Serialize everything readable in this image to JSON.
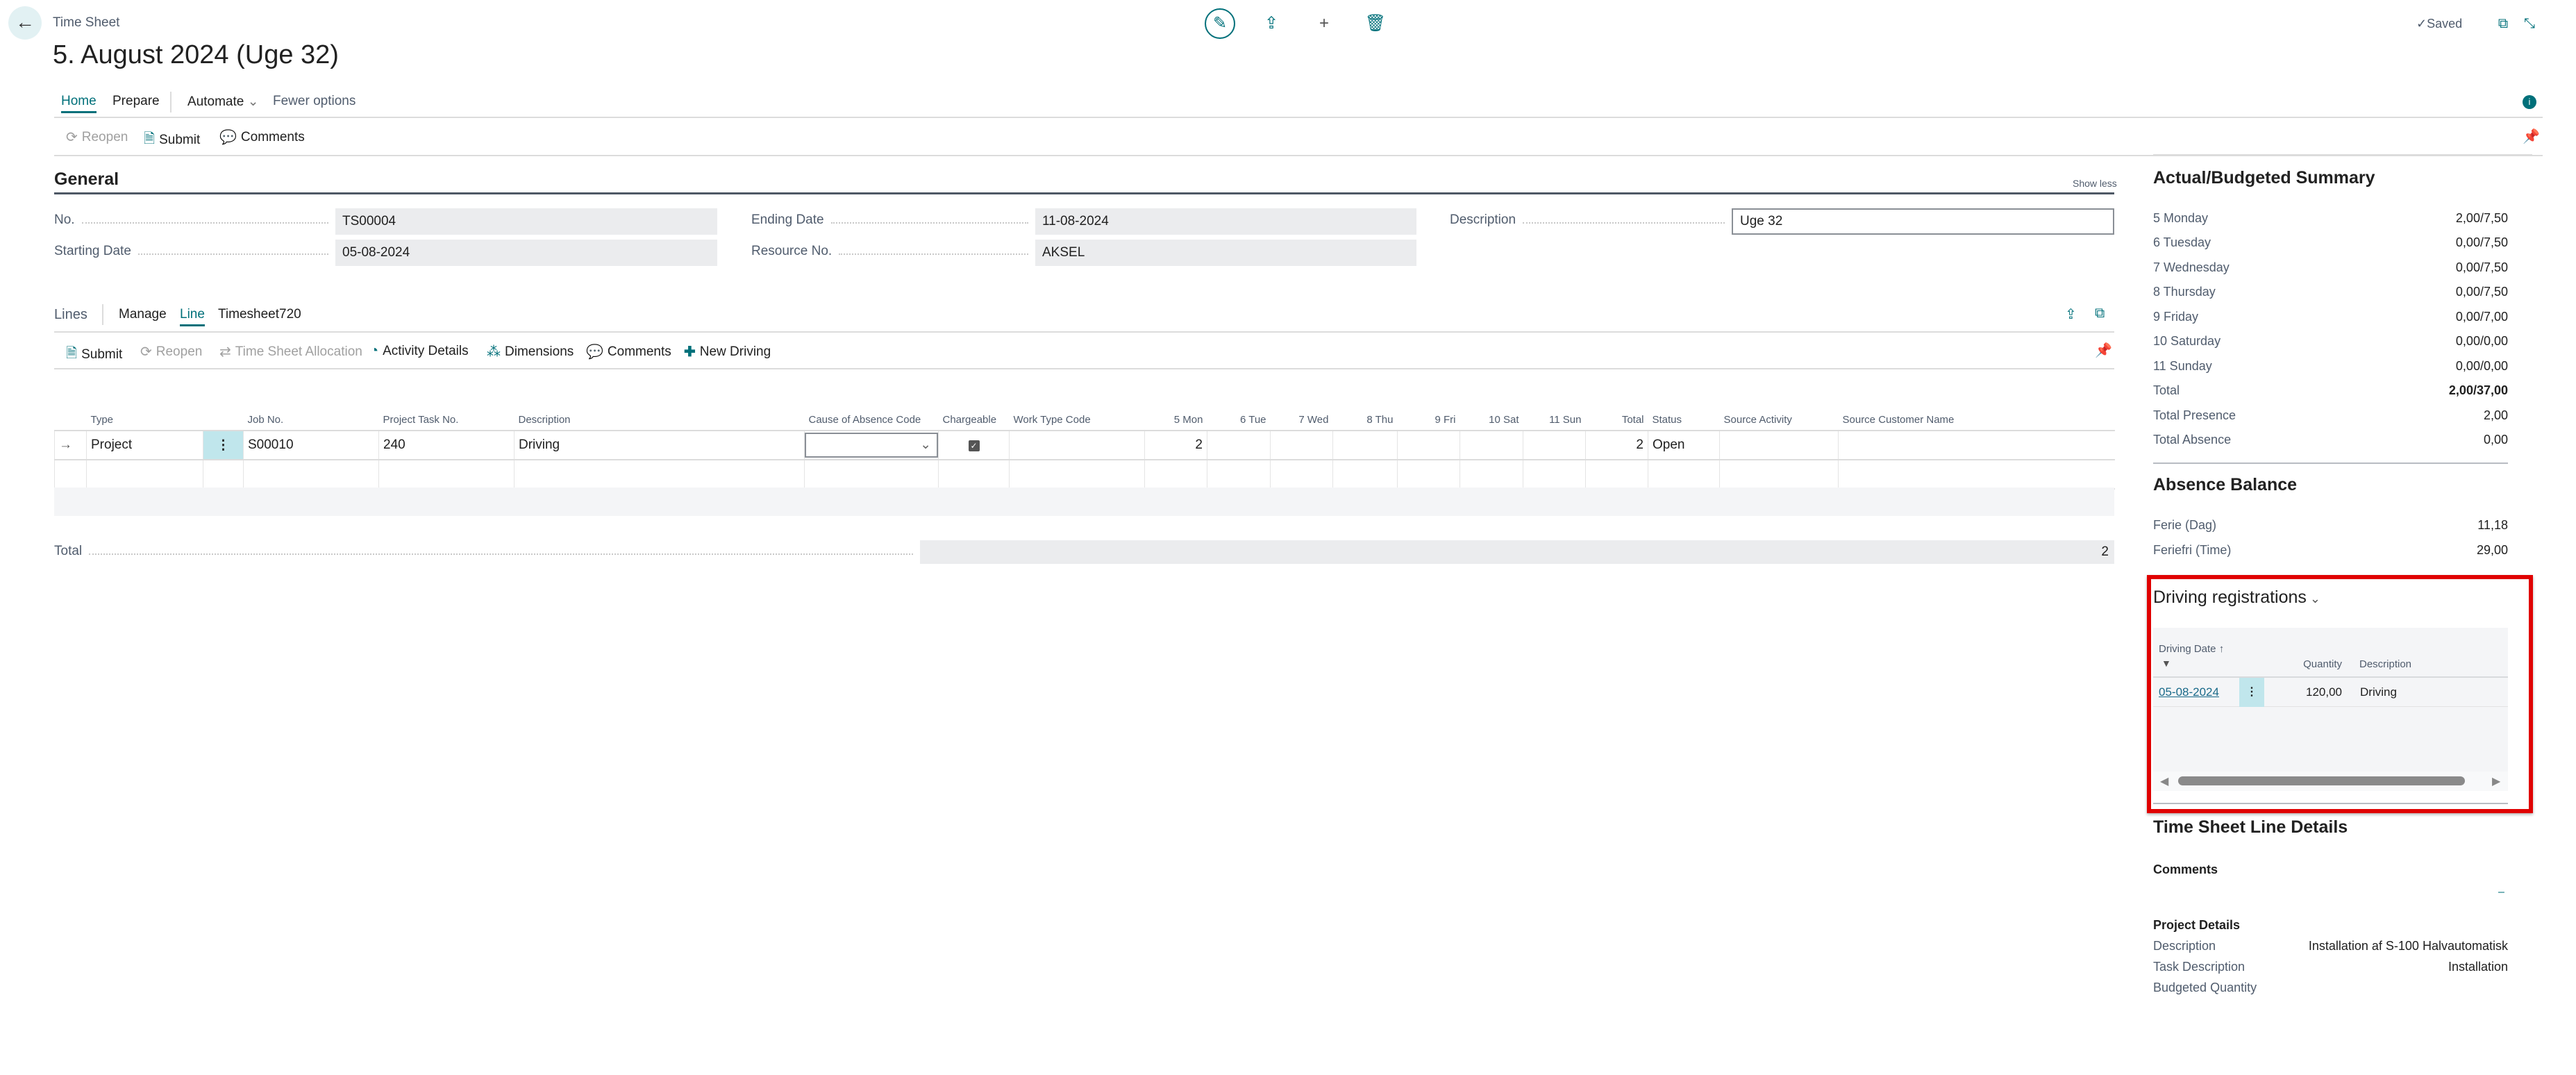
{
  "header": {
    "breadcrumb": "Time Sheet",
    "title": "5. August 2024 (Uge 32)",
    "saved": "Saved"
  },
  "tabs": [
    {
      "label": "Home",
      "active": true
    },
    {
      "label": "Prepare"
    },
    {
      "label": "Automate"
    },
    {
      "label": "Fewer options"
    }
  ],
  "actions": [
    {
      "label": "Reopen",
      "icon": "reopen-icon",
      "disabled": true
    },
    {
      "label": "Submit",
      "icon": "submit-icon"
    },
    {
      "label": "Comments",
      "icon": "comments-icon"
    }
  ],
  "general": {
    "heading": "General",
    "show_less": "Show less",
    "no_label": "No.",
    "no_value": "TS00004",
    "starting_date_label": "Starting Date",
    "starting_date_value": "05-08-2024",
    "ending_date_label": "Ending Date",
    "ending_date_value": "11-08-2024",
    "resource_label": "Resource No.",
    "resource_value": "AKSEL",
    "description_label": "Description",
    "description_value": "Uge 32"
  },
  "lines": {
    "heading": "Lines",
    "tabs": [
      {
        "label": "Manage"
      },
      {
        "label": "Line",
        "active": true
      },
      {
        "label": "Timesheet720"
      }
    ],
    "actions": [
      {
        "label": "Submit",
        "icon": "submit-icon"
      },
      {
        "label": "Reopen",
        "icon": "reopen-icon",
        "disabled": true
      },
      {
        "label": "Time Sheet Allocation",
        "icon": "allocation-icon",
        "disabled": true
      },
      {
        "label": "Activity Details",
        "icon": "activity-icon"
      },
      {
        "label": "Dimensions",
        "icon": "dimensions-icon"
      },
      {
        "label": "Comments",
        "icon": "comments-icon"
      },
      {
        "label": "New Driving",
        "icon": "plus-icon"
      }
    ],
    "columns": [
      "",
      "Type",
      "",
      "Job No.",
      "Project Task No.",
      "Description",
      "Cause of Absence Code",
      "Chargeable",
      "Work Type Code",
      "5 Mon",
      "6 Tue",
      "7 Wed",
      "8 Thu",
      "9 Fri",
      "10 Sat",
      "11 Sun",
      "Total",
      "Status",
      "Source Activity",
      "Source Customer Name"
    ],
    "rows": [
      [
        "→",
        "Project",
        "⋮",
        "S00010",
        "240",
        "Driving",
        "",
        "checked",
        "",
        "2",
        "",
        "",
        "",
        "",
        "",
        "",
        "2",
        "Open",
        "",
        ""
      ],
      [
        "",
        "",
        "",
        "",
        "",
        "",
        "",
        "",
        "",
        "",
        "",
        "",
        "",
        "",
        "",
        "",
        "",
        "",
        "",
        ""
      ]
    ],
    "total_label": "Total",
    "total_value": "2"
  },
  "summary": {
    "heading": "Actual/Budgeted Summary",
    "rows": [
      {
        "k": "5 Monday",
        "v": "2,00/7,50"
      },
      {
        "k": "6 Tuesday",
        "v": "0,00/7,50"
      },
      {
        "k": "7 Wednesday",
        "v": "0,00/7,50"
      },
      {
        "k": "8 Thursday",
        "v": "0,00/7,50"
      },
      {
        "k": "9 Friday",
        "v": "0,00/7,00"
      },
      {
        "k": "10 Saturday",
        "v": "0,00/0,00"
      },
      {
        "k": "11 Sunday",
        "v": "0,00/0,00"
      },
      {
        "k": "Total",
        "v": "2,00/37,00"
      },
      {
        "k": "Total Presence",
        "v": "2,00"
      },
      {
        "k": "Total Absence",
        "v": "0,00"
      }
    ]
  },
  "absence": {
    "heading": "Absence Balance",
    "rows": [
      {
        "k": "Ferie (Dag)",
        "v": "11,18"
      },
      {
        "k": "Feriefri (Time)",
        "v": "29,00"
      }
    ]
  },
  "driving": {
    "heading": "Driving registrations",
    "col_date": "Driving Date",
    "sort_arrow": "↑",
    "col_quantity": "Quantity",
    "col_description": "Description",
    "row": {
      "date": "05-08-2024",
      "quantity": "120,00",
      "description": "Driving"
    },
    "highlight_color": "#e00000"
  },
  "details": {
    "heading": "Time Sheet Line Details",
    "comments": "Comments",
    "comments_value": "–",
    "project_details": "Project Details",
    "rows": [
      {
        "k": "Description",
        "v": "Installation af S-100 Halvautomatisk"
      },
      {
        "k": "Task Description",
        "v": "Installation"
      },
      {
        "k": "Budgeted Quantity",
        "v": ""
      }
    ]
  },
  "colors": {
    "accent": "#00707a",
    "field_bg": "#ebecee",
    "dots_cell": "#c0e6ec"
  }
}
